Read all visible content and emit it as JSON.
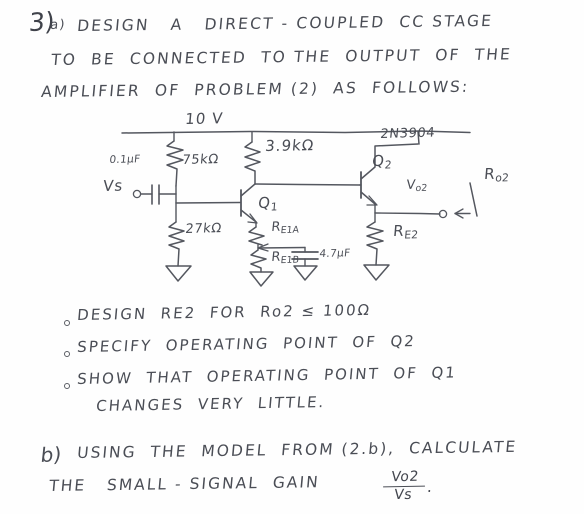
{
  "document": {
    "type": "handwritten-homework",
    "problem_number": "3",
    "ink_color": "#4a4d55",
    "paper_color": "#fefefe"
  },
  "heading": {
    "number": "3)",
    "part": "a)",
    "line1": "DESIGN   A   DIRECT - COUPLED  CC STAGE",
    "line2": "TO  BE  CONNECTED  TO THE  OUTPUT  OF  THE",
    "line3": "AMPLIFIER  OF  PROBLEM (2)  AS  FOLLOWS:"
  },
  "circuit": {
    "supply_label": "10 V",
    "input_source_label": "Vs",
    "coupling_cap": "0.1µF",
    "r_bias_upper": "75kΩ",
    "r_bias_lower": "27kΩ",
    "r_collector": "3.9kΩ",
    "q1_label": "Q",
    "q1_sub": "1",
    "q2_label": "Q",
    "q2_sub": "2",
    "transistor_part": "2N3904",
    "re1a_label": "RE1A",
    "re1b_label": "RE1B",
    "bypass_cap": "4.7µF",
    "re2_label": "RE2",
    "output_label": "Vo2",
    "output_resistance_label": "Ro2"
  },
  "requirements": [
    "DESIGN  RE2  FOR  Ro2 ≤ 100Ω",
    "SPECIFY  OPERATING  POINT  OF  Q2",
    "SHOW  THAT  OPERATING  POINT  OF  Q1",
    "CHANGES  VERY  LITTLE."
  ],
  "part_b": {
    "label": "b)",
    "line1": "USING  THE  MODEL  FROM (2.b),  CALCULATE",
    "line2": "THE   SMALL - SIGNAL  GAIN",
    "gain_numerator": "Vo2",
    "gain_denominator": "Vs",
    "trailing_period": "."
  }
}
